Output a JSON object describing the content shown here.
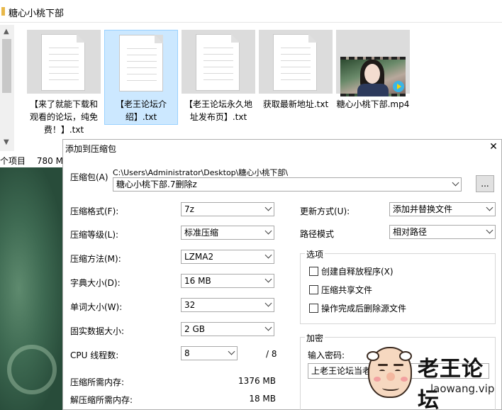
{
  "explorer": {
    "title": "糖心小桃下部",
    "files": [
      {
        "name": "【来了就能下载和观看的论坛，纯免费！】.txt",
        "type": "txt"
      },
      {
        "name": "【老王论坛介绍】.txt",
        "type": "txt",
        "selected": true
      },
      {
        "name": "【老王论坛永久地址发布页】.txt",
        "type": "txt"
      },
      {
        "name": "获取最新地址.txt",
        "type": "txt"
      },
      {
        "name": "糖心小桃下部.mp4",
        "type": "video"
      }
    ],
    "status": {
      "items": "个项目",
      "size": "780 MB"
    }
  },
  "dialog": {
    "title": "添加到压缩包",
    "close_glyph": "✕",
    "archive": {
      "label": "压缩包(A)",
      "path": "C:\\Users\\Administrator\\Desktop\\糖心小桃下部\\",
      "value": "糖心小桃下部.7删除z",
      "browse_label": "..."
    },
    "fields": [
      {
        "label": "压缩格式(F):",
        "value": "7z"
      },
      {
        "label": "压缩等级(L):",
        "value": "标准压缩"
      },
      {
        "label": "压缩方法(M):",
        "value": "LZMA2"
      },
      {
        "label": "字典大小(D):",
        "value": "16 MB"
      },
      {
        "label": "单词大小(W):",
        "value": "32"
      },
      {
        "label": "固实数据大小:",
        "value": "2 GB"
      },
      {
        "label": "CPU 线程数:",
        "value": "8",
        "suffix": "/ 8"
      }
    ],
    "memory": [
      {
        "label": "压缩所需内存:",
        "value": "1376 MB"
      },
      {
        "label": "解压缩所需内存:",
        "value": "18 MB"
      }
    ],
    "update_mode": {
      "label": "更新方式(U):",
      "value": "添加并替换文件"
    },
    "path_mode": {
      "label": "路径模式",
      "value": "相对路径"
    },
    "options": {
      "legend": "选项",
      "items": [
        "创建自释放程序(X)",
        "压缩共享文件",
        "操作完成后删除源文件"
      ]
    },
    "encryption": {
      "legend": "加密",
      "password_label": "输入密码:",
      "password_value": "上老王论坛当老"
    }
  },
  "watermark": {
    "title": "老王论坛",
    "url": "laowang.vip"
  }
}
